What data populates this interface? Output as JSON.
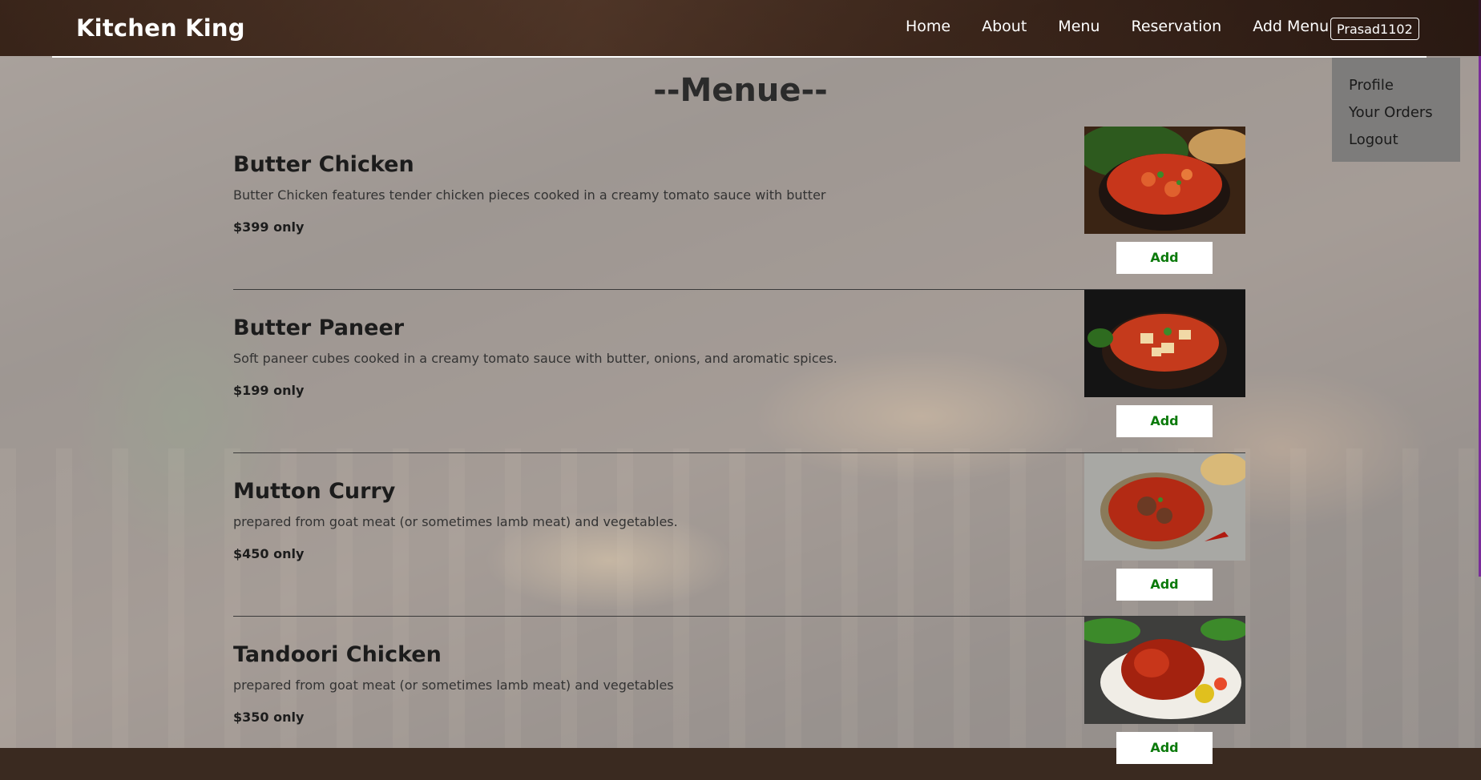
{
  "brand": "Kitchen King",
  "nav": {
    "links": [
      "Home",
      "About",
      "Menu",
      "Reservation",
      "Add Menu"
    ],
    "user": "Prasad1102"
  },
  "dropdown": {
    "items": [
      "Profile",
      "Your Orders",
      "Logout"
    ]
  },
  "page_title": "--Menue--",
  "menu": {
    "add_label": "Add",
    "items": [
      {
        "name": "Butter Chicken",
        "description": "Butter Chicken features tender chicken pieces cooked in a creamy tomato sauce with butter",
        "price": "$399 only"
      },
      {
        "name": "Butter Paneer",
        "description": "Soft paneer cubes cooked in a creamy tomato sauce with butter, onions, and aromatic spices.",
        "price": "$199 only"
      },
      {
        "name": "Mutton Curry",
        "description": "prepared from goat meat (or sometimes lamb meat) and vegetables.",
        "price": "$450 only"
      },
      {
        "name": "Tandoori Chicken",
        "description": "prepared from goat meat (or sometimes lamb meat) and vegetables",
        "price": "$350 only"
      }
    ]
  },
  "colors": {
    "add_text": "#0b7a0b",
    "accent_edge": "#7a2c9a"
  }
}
